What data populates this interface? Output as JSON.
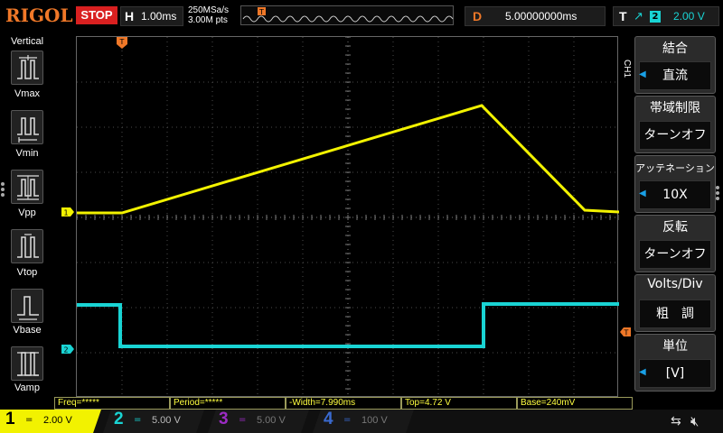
{
  "header": {
    "brand": "RIGOL",
    "run_state": "STOP",
    "timebase_label": "H",
    "timebase_value": "1.00ms",
    "sample_rate": "250MSa/s",
    "memory_depth": "3.00M pts",
    "trigger_marker": "T",
    "delay_label": "D",
    "delay_value": "5.00000000ms",
    "trigger_label": "T",
    "trigger_edge": "↗",
    "trigger_source": "2",
    "trigger_level": "2.00 V"
  },
  "measure_panel": {
    "title": "Vertical",
    "items": [
      {
        "label": "Vmax"
      },
      {
        "label": "Vmin"
      },
      {
        "label": "Vpp"
      },
      {
        "label": "Vtop"
      },
      {
        "label": "Vbase"
      },
      {
        "label": "Vamp"
      }
    ]
  },
  "channel_menu": {
    "channel_tag": "CH1",
    "items": [
      {
        "title": "結合",
        "value": "直流",
        "has_arrow": true
      },
      {
        "title": "帯域制限",
        "value": "ターンオフ",
        "has_arrow": false
      },
      {
        "title": "アッテネーション",
        "value": "10X",
        "has_arrow": true
      },
      {
        "title": "反転",
        "value": "ターンオフ",
        "has_arrow": false
      },
      {
        "title": "Volts/Div",
        "value": "粗　調",
        "has_arrow": false
      },
      {
        "title": "単位",
        "value": "[V]",
        "has_arrow": true
      }
    ]
  },
  "markers": {
    "ch1": "1",
    "ch2": "2",
    "trigger_pos": "T"
  },
  "measurements": [
    {
      "text": "Freq=*****"
    },
    {
      "text": "Period=*****"
    },
    {
      "text": "-Width=7.990ms"
    },
    {
      "text": "Top=4.72 V"
    },
    {
      "text": "Base=240mV"
    }
  ],
  "channels": [
    {
      "num": "1",
      "coupling": "=",
      "scale": "2.00 V",
      "color": "#f2f200",
      "active": true
    },
    {
      "num": "2",
      "coupling": "=",
      "scale": "5.00 V",
      "color": "#19d4d4",
      "active": false
    },
    {
      "num": "3",
      "coupling": "=",
      "scale": "5.00 V",
      "color": "#9b2bc4",
      "active": false
    },
    {
      "num": "4",
      "coupling": "=",
      "scale": "100 V",
      "color": "#3a6ad0",
      "active": false
    }
  ],
  "status_icons": [
    "usb-icon",
    "mute-icon"
  ],
  "colors": {
    "ch1": "#f2f200",
    "ch2": "#19d4d4",
    "trigger": "#f07828",
    "menu_arrow": "#19a0e6",
    "stop": "#d92020"
  }
}
